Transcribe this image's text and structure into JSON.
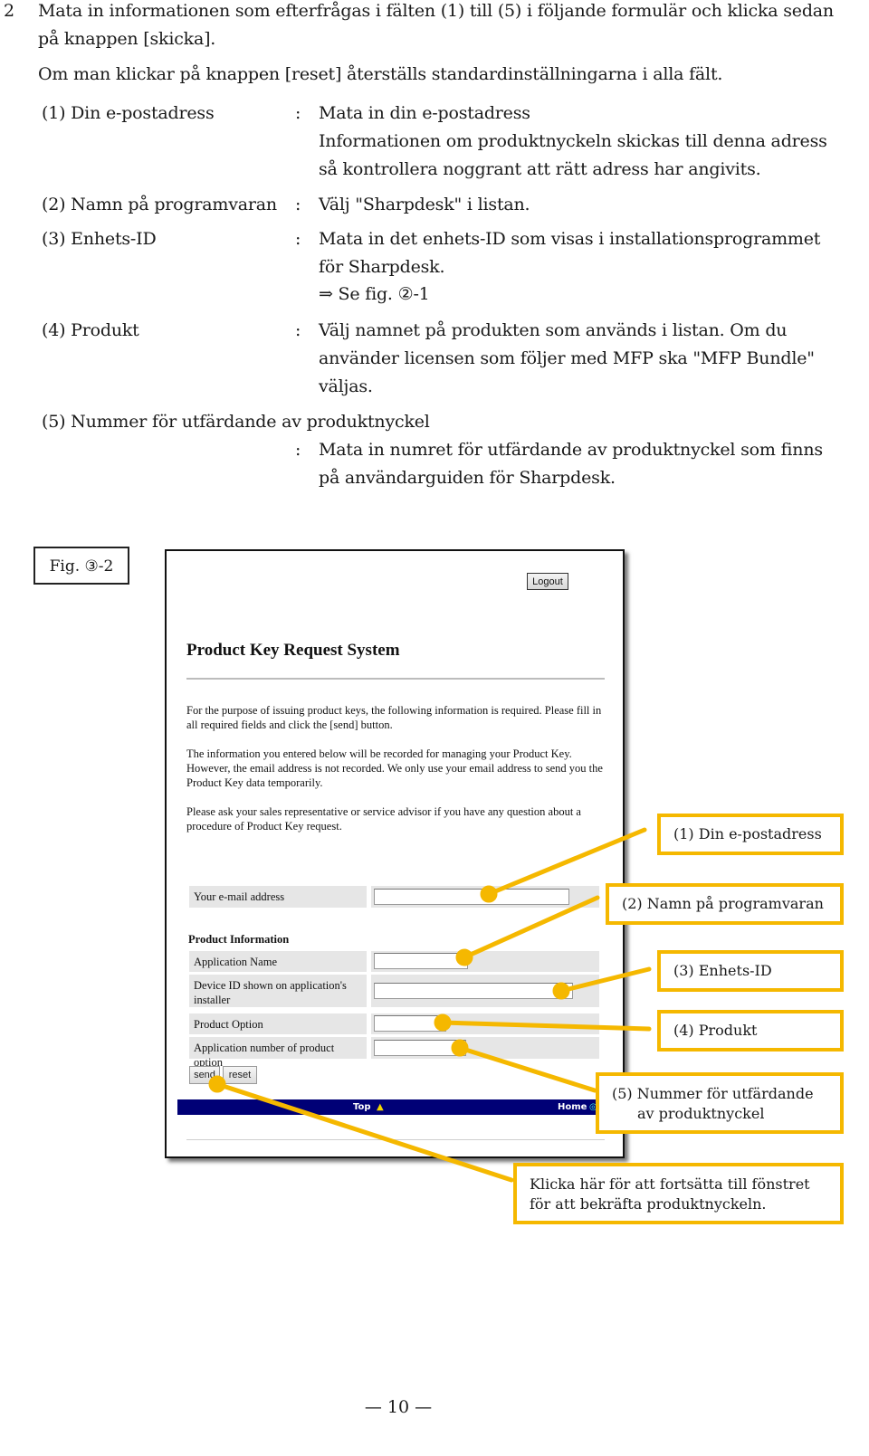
{
  "instructions": {
    "step_number": "2",
    "line1": "Mata in informationen som efterfrågas i fälten (1) till (5) i följande formulär och klicka sedan",
    "line2": "på knappen [skicka].",
    "line3": "Om man klickar på knappen [reset] återställs standardinställningarna i alla fält."
  },
  "items": [
    {
      "label": "(1)  Din e-postadress",
      "colon": ":",
      "lines": [
        "Mata in din e-postadress",
        "Informationen om produktnyckeln skickas till denna adress",
        "så kontrollera noggrant att rätt adress har angivits."
      ]
    },
    {
      "label": "(2)  Namn på programvaran",
      "colon": ":",
      "lines": [
        "Välj \"Sharpdesk\" i listan."
      ]
    },
    {
      "label": "(3)  Enhets-ID",
      "colon": ":",
      "lines": [
        "Mata in det enhets-ID som visas i installationsprogrammet",
        "för Sharpdesk.",
        "⇒ Se fig.  ②-1"
      ]
    },
    {
      "label": "(4)  Produkt",
      "colon": ":",
      "lines": [
        "Välj namnet på produkten som används i listan. Om du",
        "använder licensen som följer med MFP ska \"MFP Bundle\"",
        "väljas."
      ]
    },
    {
      "label": "(5)  Nummer för utfärdande av produktnyckel",
      "colon": ":",
      "lines": [
        "Mata in numret för utfärdande av produktnyckel som finns",
        "på användarguiden för Sharpdesk."
      ]
    }
  ],
  "figure": {
    "label": "Fig.  ③-2",
    "screenshot": {
      "logout_label": "Logout",
      "title": "Product Key Request System",
      "paragraphs": [
        "For the purpose of issuing product keys, the following information is required. Please fill in all required fields and click the [send] button.",
        "The information you entered below will be recorded for managing your Product Key. However, the email address is not recorded. We only use your email address to send you the Product Key data temporarily.",
        "Please ask your sales representative or service advisor if you have any question about a procedure of Product Key request."
      ],
      "email_label": "Your e-mail address",
      "email_value": "",
      "section_heading": "Product Information",
      "app_name_label": "Application Name",
      "app_name_value": "",
      "device_id_label": "Device ID shown on application's installer",
      "device_id_value": "",
      "product_option_label": "Product Option",
      "product_option_value": "",
      "app_number_label": "Application number of product option",
      "app_number_value": "",
      "send_label": "send",
      "reset_label": "reset",
      "nav_top_label": "Top",
      "nav_home_label": "Home"
    },
    "callouts": [
      {
        "text": "(1) Din e-postadress"
      },
      {
        "text": "(2) Namn på programvaran"
      },
      {
        "text": "(3) Enhets-ID"
      },
      {
        "text": "(4) Produkt"
      },
      {
        "text": "(5) Nummer för utfärdande",
        "text2": "av produktnyckel"
      },
      {
        "text": "Klicka här för att fortsätta till fönstret",
        "text2": "för att bekräfta produktnyckeln."
      }
    ],
    "callout_color": "#f5b800"
  },
  "footer": {
    "page_number": "— 10 —"
  }
}
